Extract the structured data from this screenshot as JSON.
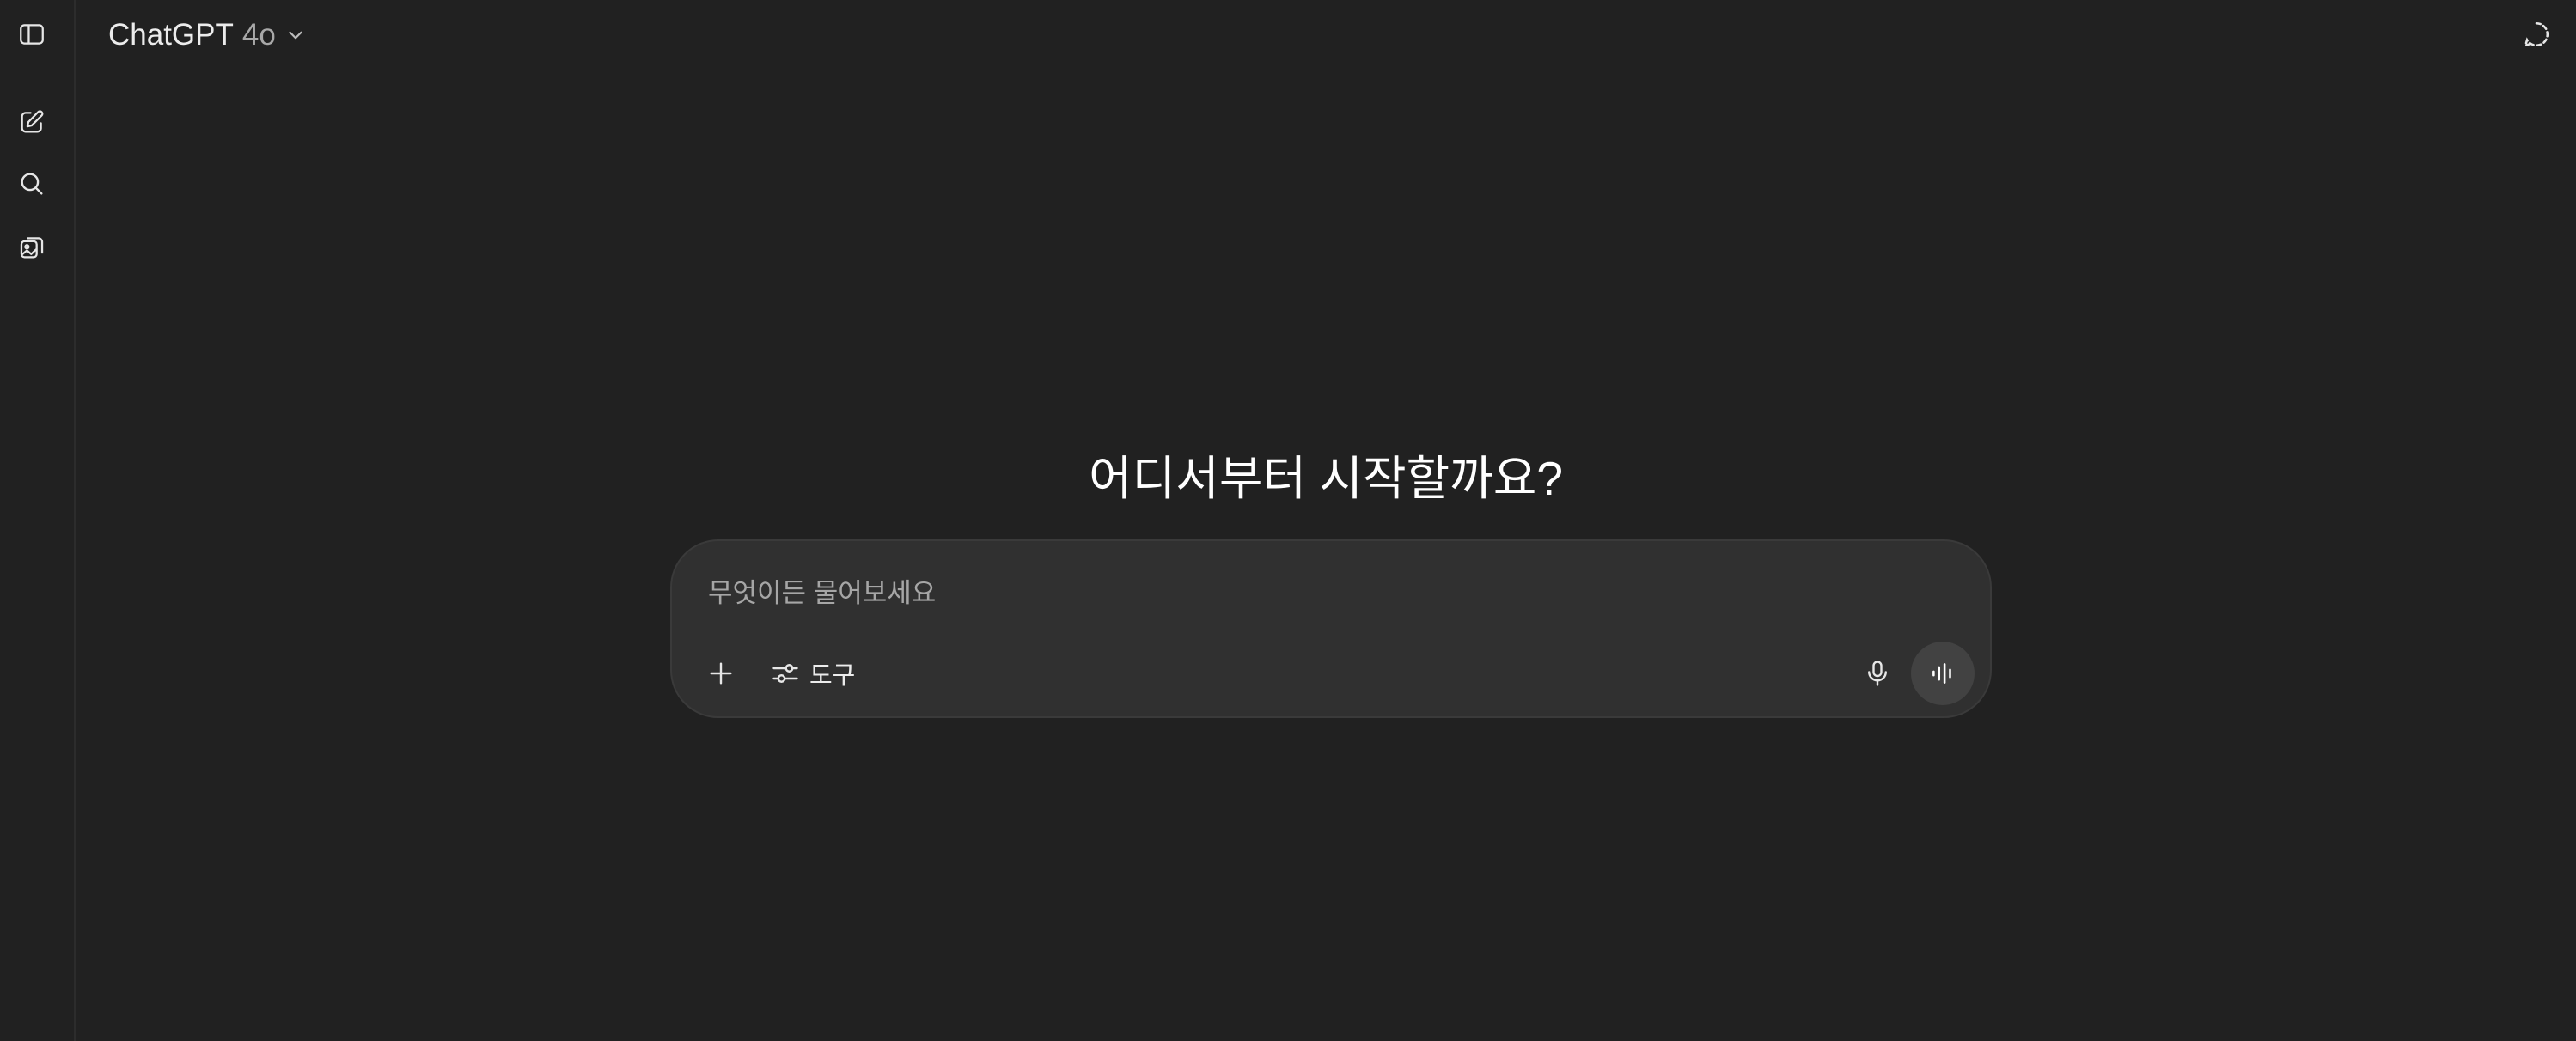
{
  "header": {
    "model_name": "ChatGPT",
    "model_version": "4o"
  },
  "sidebar": {
    "icons": [
      "sidebar-toggle-icon",
      "new-chat-icon",
      "search-icon",
      "library-icon"
    ]
  },
  "main": {
    "title": "어디서부터 시작할까요?"
  },
  "composer": {
    "placeholder": "무엇이든 물어보세요",
    "tools_label": "도구"
  }
}
